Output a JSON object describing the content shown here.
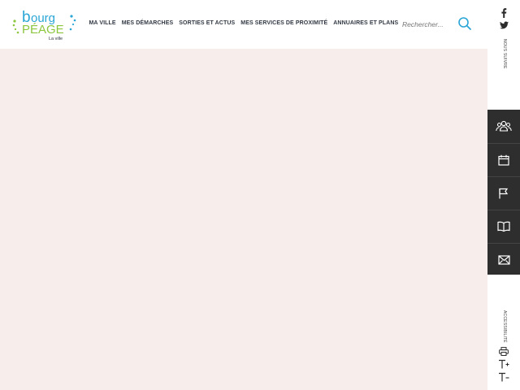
{
  "logo": {
    "line1": "ourg",
    "letter_b": "b",
    "line2": "péage",
    "tagline": "La ville",
    "colors": {
      "blue": "#2aa6d6",
      "green": "#8cc63f",
      "dark": "#2b3340"
    }
  },
  "nav": {
    "items": [
      {
        "label": "MA VILLE"
      },
      {
        "label": "MES DÉMARCHES"
      },
      {
        "label": "SORTIES ET ACTUS"
      },
      {
        "label": "MES SERVICES DE PROXIMITÉ"
      },
      {
        "label": "ANNUAIRES ET PLANS"
      }
    ]
  },
  "search": {
    "placeholder": "Rechercher...",
    "icon": "search-icon",
    "icon_color": "#2aa6d6"
  },
  "main": {
    "background": "#f7eeec"
  },
  "rail": {
    "social": [
      {
        "icon": "facebook-icon"
      },
      {
        "icon": "twitter-icon"
      }
    ],
    "follow_label": "NOUS SUIVRE",
    "quick_links": [
      {
        "icon": "group-icon"
      },
      {
        "icon": "calendar-icon"
      },
      {
        "icon": "flag-icon"
      },
      {
        "icon": "book-icon"
      },
      {
        "icon": "mail-icon"
      }
    ],
    "quick_bar_color": "#2e2e2e",
    "accessibility_label": "ACCESSIBILITÉ",
    "tools": [
      {
        "icon": "print-icon"
      },
      {
        "icon": "text-increase-icon",
        "label": "T+"
      },
      {
        "icon": "text-decrease-icon",
        "label": "T-"
      }
    ]
  }
}
